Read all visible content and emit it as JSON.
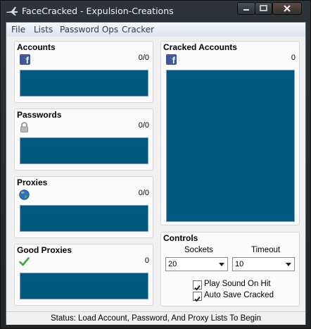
{
  "window": {
    "title": "FaceCracked - Expulsion-Creations",
    "icons": {
      "app": "airplane-icon",
      "minimize": "minimize-icon",
      "maximize": "maximize-icon",
      "close": "close-icon"
    }
  },
  "menu": {
    "items": [
      "File",
      "Lists",
      "Password Ops",
      "Cracker"
    ]
  },
  "panels": {
    "accounts": {
      "label": "Accounts",
      "count": "0/0",
      "icon": "facebook-icon"
    },
    "passwords": {
      "label": "Passwords",
      "count": "0/0",
      "icon": "padlock-icon"
    },
    "proxies": {
      "label": "Proxies",
      "count": "0/0",
      "icon": "globe-icon"
    },
    "good_proxies": {
      "label": "Good Proxies",
      "count": "0",
      "icon": "checkmark-icon"
    },
    "cracked": {
      "label": "Cracked Accounts",
      "count": "0",
      "icon": "facebook-icon"
    }
  },
  "controls": {
    "label": "Controls",
    "sockets_label": "Sockets",
    "sockets_value": "20",
    "timeout_label": "Timeout",
    "timeout_value": "10",
    "play_sound": {
      "label": "Play Sound On Hit",
      "checked": true
    },
    "auto_save": {
      "label": "Auto Save Cracked",
      "checked": true
    }
  },
  "status": {
    "text": "Status: Load Account, Password, And Proxy Lists To Begin"
  },
  "colors": {
    "list_bg": "#005a80",
    "facebook_blue": "#3b5998",
    "titlebar": "#2b3135"
  }
}
